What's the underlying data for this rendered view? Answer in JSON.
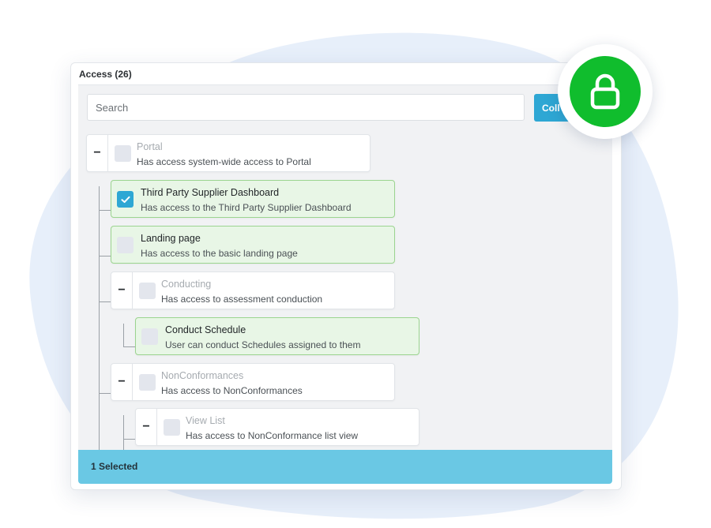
{
  "panel": {
    "title": "Access (26)"
  },
  "search": {
    "placeholder": "Search"
  },
  "toolbar": {
    "collapse_label": "Coll"
  },
  "tree": {
    "nodes": [
      {
        "title": "Portal",
        "desc": "Has access system-wide access to Portal",
        "checked": false,
        "expandable": true,
        "toggle": "−"
      },
      {
        "title": "Third Party Supplier Dashboard",
        "desc": "Has access to the Third Party Supplier Dashboard",
        "checked": true,
        "expandable": false
      },
      {
        "title": "Landing page",
        "desc": "Has access to the basic landing page",
        "checked": false,
        "expandable": false
      },
      {
        "title": "Conducting",
        "desc": "Has access to assessment conduction",
        "checked": false,
        "expandable": true,
        "toggle": "−"
      },
      {
        "title": "Conduct Schedule",
        "desc": "User can conduct Schedules assigned to them",
        "checked": false,
        "expandable": false
      },
      {
        "title": "NonConformances",
        "desc": "Has access to NonConformances",
        "checked": false,
        "expandable": true,
        "toggle": "−"
      },
      {
        "title": "View List",
        "desc": "Has access to NonConformance list view",
        "checked": false,
        "expandable": true,
        "toggle": "−"
      }
    ]
  },
  "footer": {
    "selected_text": "1 Selected"
  },
  "colors": {
    "accent": "#2ea7d4",
    "footer": "#6ac8e4",
    "lock": "#10bd2d",
    "active_node": "#e8f6e6",
    "blob": "#e7effa"
  },
  "icons": {
    "lock": "lock-icon",
    "check": "checkmark-icon",
    "blob": "decorative-blob"
  }
}
